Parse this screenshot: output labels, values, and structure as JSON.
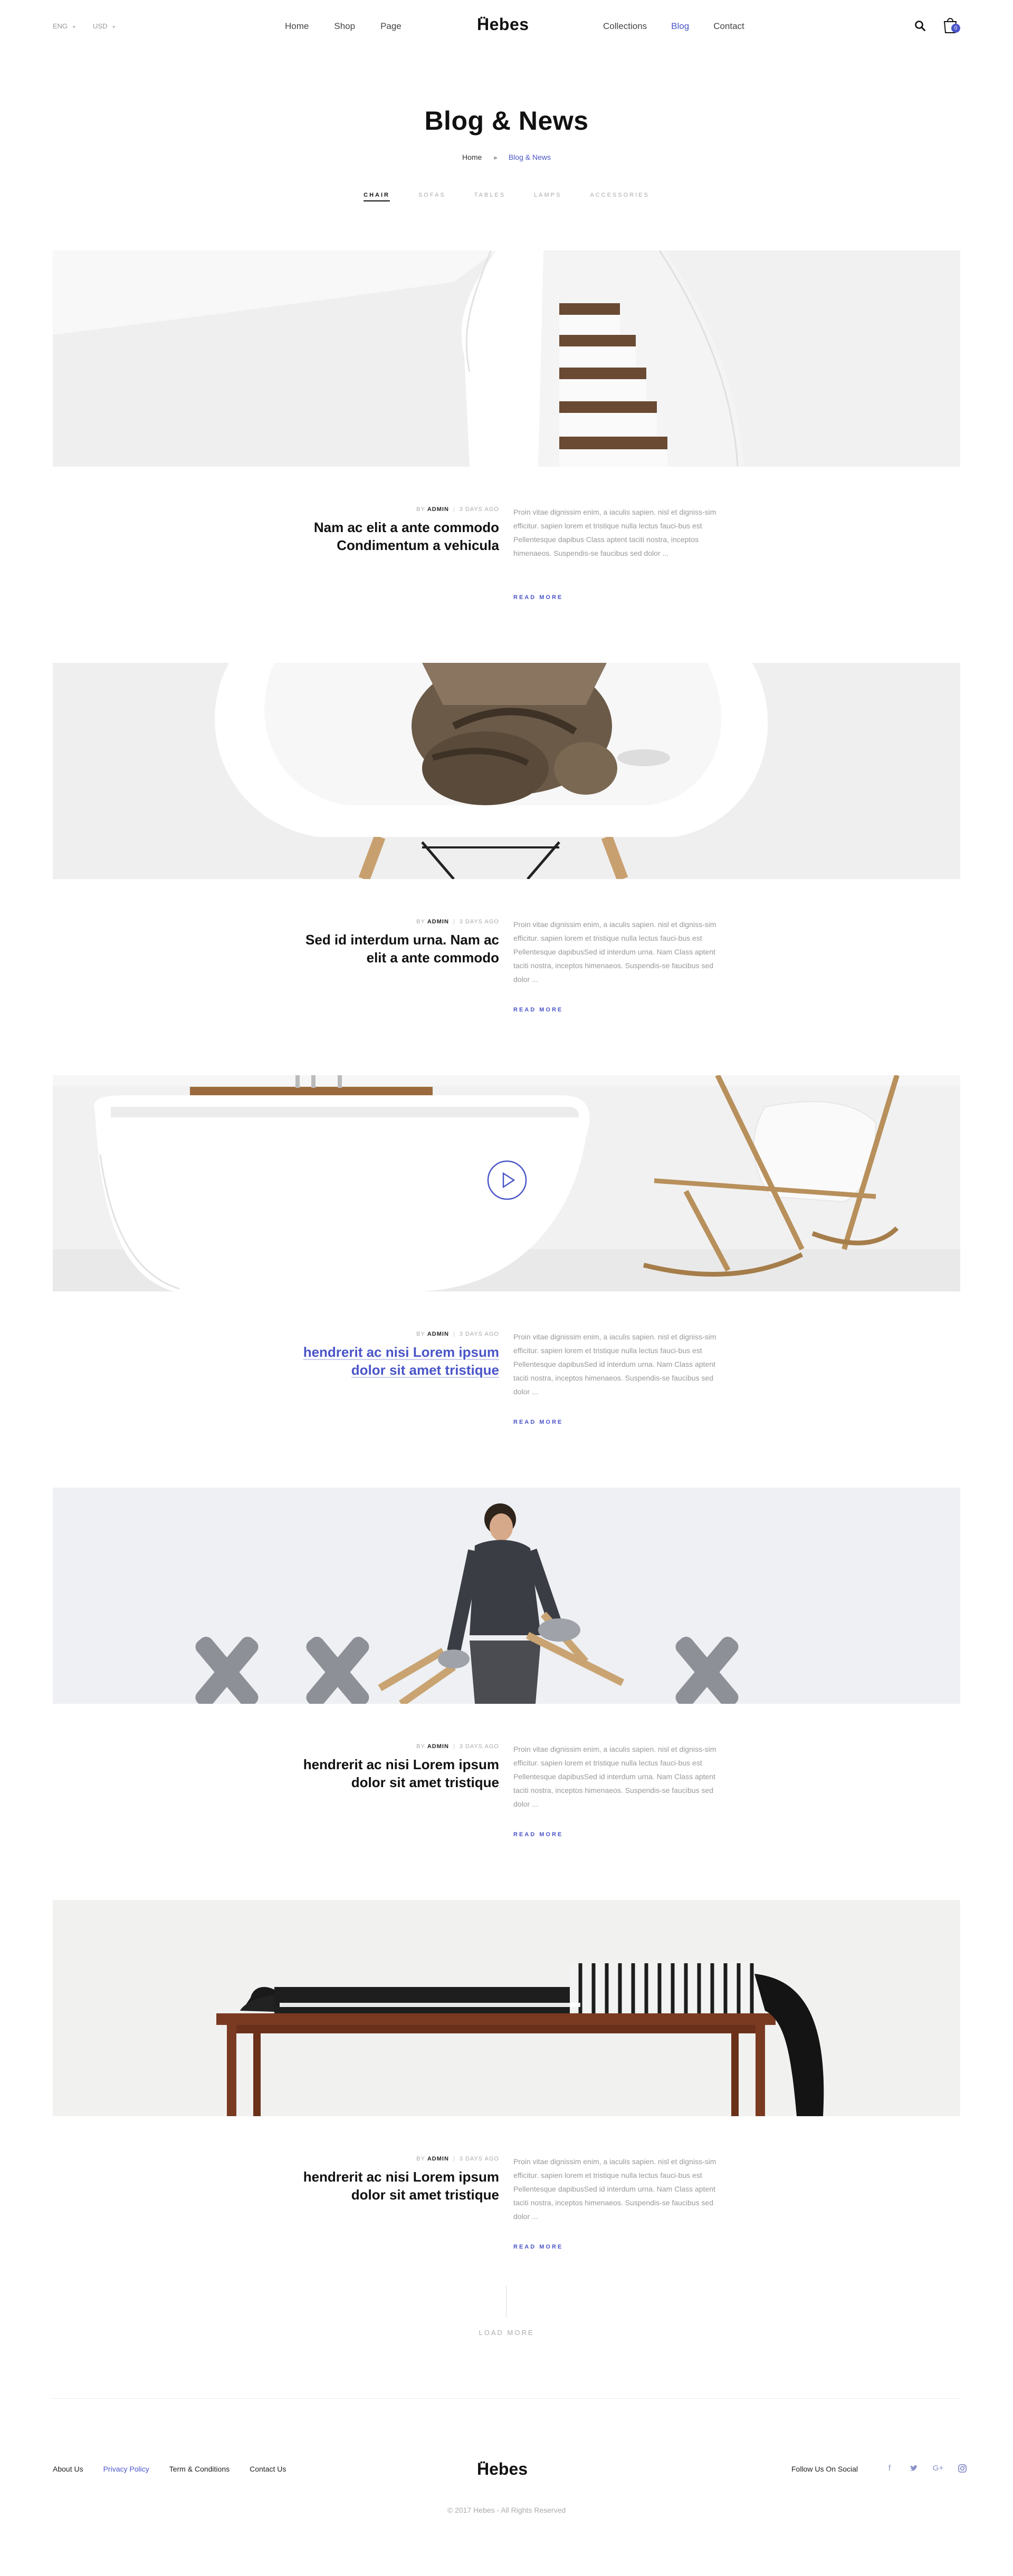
{
  "header": {
    "language": "ENG",
    "currency": "USD",
    "nav_left": [
      "Home",
      "Shop",
      "Page"
    ],
    "nav_right": [
      "Collections",
      "Blog",
      "Contact"
    ],
    "active_nav": "Blog",
    "logo": "Hebes",
    "cart_count": "0",
    "icons": [
      "search-icon",
      "cart-icon",
      "chevron-down-icon"
    ]
  },
  "page": {
    "title": "Blog & News",
    "breadcrumb": {
      "home": "Home",
      "separator": "»",
      "current": "Blog & News"
    },
    "categories": [
      "CHAIR",
      "SOFAS",
      "TABLES",
      "LAMPS",
      "ACCESSORIES"
    ],
    "active_category": "CHAIR"
  },
  "posts": [
    {
      "by": "BY",
      "author": "ADMIN",
      "date": "3 DAYS AGO",
      "title_line1": "Nam ac elit a ante commodo",
      "title_line2": "Condimentum a vehicula",
      "excerpt": "Proin vitae dignissim enim, a iaculis sapien. nisl et digniss-sim efficitur. sapien lorem et tristique nulla lectus fauci-bus est Pellentesque dapibus Class aptent taciti nostra, inceptos himenaeos. Suspendis-se faucibus sed dolor ...",
      "read_more": "READ MORE",
      "image": "white staircase"
    },
    {
      "by": "BY",
      "author": "ADMIN",
      "date": "3 DAYS AGO",
      "title_line1": "Sed id interdum urna. Nam ac",
      "title_line2": "elit a ante commodo",
      "excerpt": "Proin vitae dignissim enim, a iaculis sapien. nisl et digniss-sim efficitur. sapien lorem et tristique nulla lectus fauci-bus est Pellentesque dapibusSed id interdum urna. Nam Class aptent taciti nostra, inceptos himenaeos. Suspendis-se faucibus sed dolor ...",
      "read_more": "READ MORE",
      "image": "cat on white chair"
    },
    {
      "by": "BY",
      "author": "ADMIN",
      "date": "3 DAYS AGO",
      "title_line1": "hendrerit ac nisi Lorem ipsum",
      "title_line2": "dolor sit amet tristique",
      "excerpt": "Proin vitae dignissim enim, a iaculis sapien. nisl et digniss-sim efficitur. sapien lorem et tristique nulla lectus fauci-bus est Pellentesque dapibusSed id interdum urna. Nam Class aptent taciti nostra, inceptos himenaeos. Suspendis-se faucibus sed dolor ...",
      "read_more": "READ MORE",
      "image": "bathtub and rocking chair",
      "has_video": true
    },
    {
      "by": "BY",
      "author": "ADMIN",
      "date": "3 DAYS AGO",
      "title_line1": "hendrerit ac nisi Lorem ipsum",
      "title_line2": "dolor sit amet tristique",
      "excerpt": "Proin vitae dignissim enim, a iaculis sapien. nisl et digniss-sim efficitur. sapien lorem et tristique nulla lectus fauci-bus est Pellentesque dapibusSed id interdum urna. Nam Class aptent taciti nostra, inceptos himenaeos. Suspendis-se faucibus sed dolor ...",
      "read_more": "READ MORE",
      "image": "man with stools"
    },
    {
      "by": "BY",
      "author": "ADMIN",
      "date": "3 DAYS AGO",
      "title_line1": "hendrerit ac nisi Lorem ipsum",
      "title_line2": "dolor sit amet tristique",
      "excerpt": "Proin vitae dignissim enim, a iaculis sapien. nisl et digniss-sim efficitur. sapien lorem et tristique nulla lectus fauci-bus est Pellentesque dapibusSed id interdum urna. Nam Class aptent taciti nostra, inceptos himenaeos. Suspendis-se faucibus sed dolor ...",
      "read_more": "READ MORE",
      "image": "woman lying on table"
    }
  ],
  "load_more": "LOAD MORE",
  "footer": {
    "links": [
      "About Us",
      "Privacy Policy",
      "Term & Conditions",
      "Contact Us"
    ],
    "active_link": "Privacy Policy",
    "logo": "Hebes",
    "follow_label": "Follow Us On Social",
    "socials": [
      "facebook-icon",
      "twitter-icon",
      "google-plus-icon",
      "instagram-icon"
    ],
    "copyright": "© 2017 Hebes - All Rights Reserved"
  },
  "colors": {
    "accent": "#4a55c8",
    "text": "#111111",
    "muted": "#999999"
  }
}
